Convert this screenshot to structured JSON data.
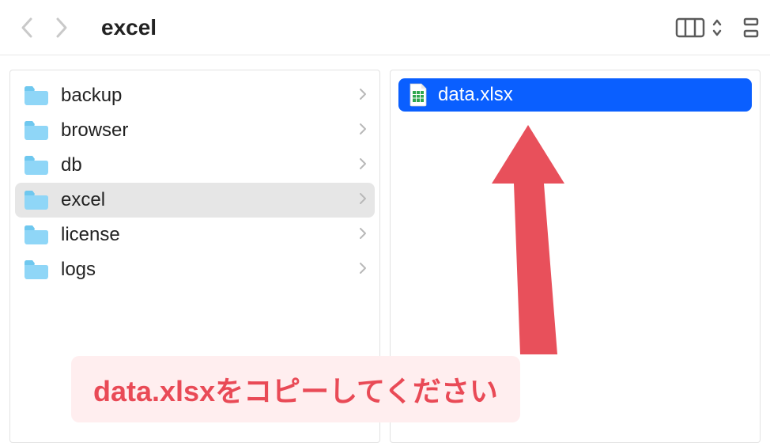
{
  "toolbar": {
    "title": "excel"
  },
  "sidebar": {
    "folders": [
      {
        "name": "backup",
        "selected": false
      },
      {
        "name": "browser",
        "selected": false
      },
      {
        "name": "db",
        "selected": false
      },
      {
        "name": "excel",
        "selected": true
      },
      {
        "name": "license",
        "selected": false
      },
      {
        "name": "logs",
        "selected": false
      }
    ]
  },
  "content": {
    "files": [
      {
        "name": "data.xlsx",
        "selected": true
      }
    ]
  },
  "annotation": {
    "text": "data.xlsxをコピーしてください"
  }
}
